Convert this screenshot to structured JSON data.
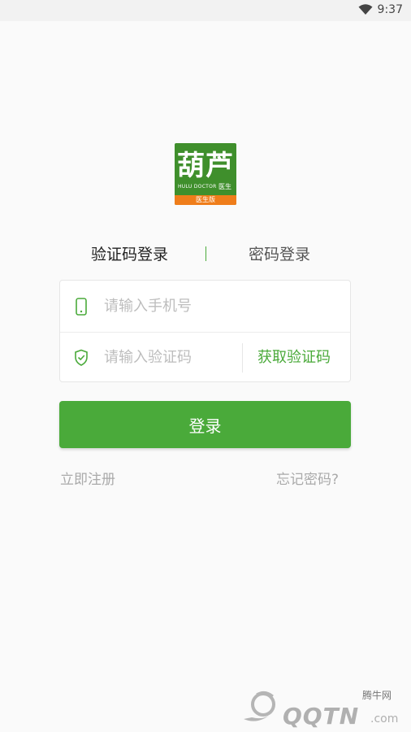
{
  "status_bar": {
    "time": "9:37",
    "icons": [
      "wifi-icon"
    ]
  },
  "logo": {
    "main_text": "葫芦",
    "sub_text": "HULU DOCTOR",
    "sub_text2": "医生",
    "band_text": "医生版"
  },
  "tabs": {
    "active": "验证码登录",
    "inactive": "密码登录"
  },
  "form": {
    "phone_placeholder": "请输入手机号",
    "code_placeholder": "请输入验证码",
    "get_code_label": "获取验证码"
  },
  "login_button": "登录",
  "links": {
    "register": "立即注册",
    "forgot": "忘记密码?"
  },
  "watermark": {
    "brand": "QQTN",
    "cn": "腾牛网",
    "suffix": ".com"
  },
  "colors": {
    "accent": "#4aaa3a",
    "logo_bg": "#3f8f2c",
    "logo_band": "#ef7d1a"
  }
}
